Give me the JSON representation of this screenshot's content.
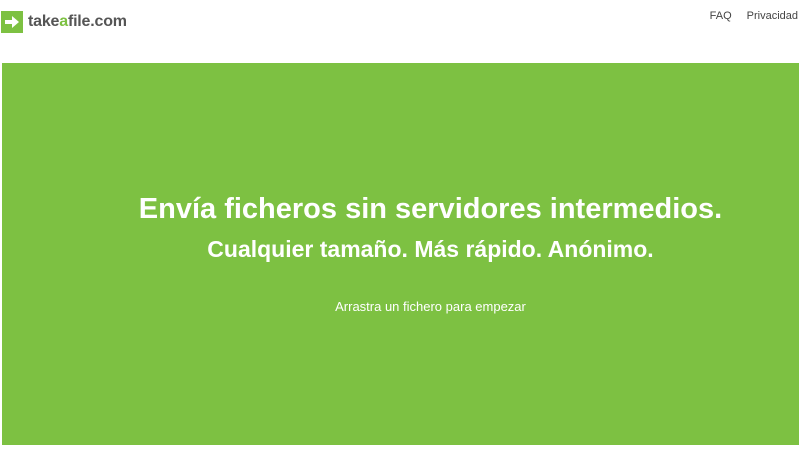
{
  "header": {
    "logo": {
      "text_before": "take",
      "text_accent": "a",
      "text_after": "file.com",
      "icon": "arrow-right-icon",
      "brand_color": "#7dc142"
    },
    "nav": {
      "faq_label": "FAQ",
      "privacy_label": "Privacidad"
    }
  },
  "hero": {
    "background_color": "#7dc142",
    "headline": "Envía ficheros sin servidores intermedios.",
    "subheadline": "Cualquier tamaño. Más rápido. Anónimo.",
    "dropzone_hint": "Arrastra un fichero para empezar"
  }
}
